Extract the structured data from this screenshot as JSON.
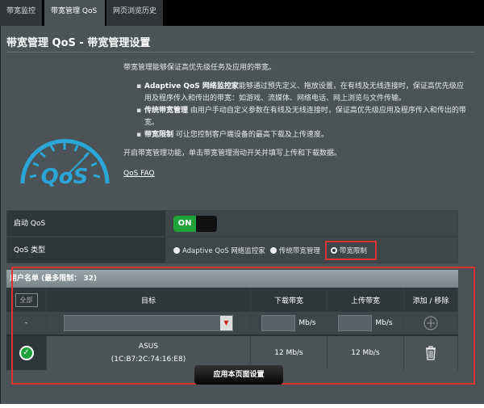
{
  "tabs": [
    {
      "label": "带宽监控"
    },
    {
      "label": "带宽管理 QoS"
    },
    {
      "label": "网页浏览历史"
    }
  ],
  "page_title": "带宽管理 QoS - 带宽管理设置",
  "logo_text": "QoS",
  "intro": "带宽管理能够保证高优先级任务及应用的带宽。",
  "bullets": [
    {
      "bold": "Adaptive QoS 网络监控家",
      "text": "能够通过预先定义、拖放设置，在有线及无线连接时，保证高优先级应用及程序传入和传出的带宽：如游戏、流媒体、网络电话、网上浏览与文件传输。"
    },
    {
      "bold": "传统带宽管理",
      "text": " 由用户手动自定义参数在有线及无线连接时，保证高优先级应用及程序传入和传出的带宽。"
    },
    {
      "bold": "带宽限制",
      "text": " 可让您控制客户端设备的最高下载及上传速度。"
    }
  ],
  "instruction": "开启带宽管理功能，单击带宽管理滑动开关并填写上传和下载数据。",
  "faq_link": "QoS FAQ",
  "settings": {
    "enable_label": "启动 QoS",
    "toggle_on": "ON",
    "type_label": "QoS 类型",
    "types": [
      {
        "label": "Adaptive QoS 网络监控家",
        "selected": false
      },
      {
        "label": "传统带宽管理",
        "selected": false
      },
      {
        "label": "带宽限制",
        "selected": true
      }
    ]
  },
  "user_list": {
    "title": "用户名单 (最多限制： 32)",
    "headers": {
      "all": "全部",
      "target": "目标",
      "download": "下载带宽",
      "upload": "上传带宽",
      "add_remove": "添加 / 移除"
    },
    "input_row": {
      "dash": "-",
      "unit": "Mb/s"
    },
    "rows": [
      {
        "name": "ASUS",
        "mac": "(1C:B7:2C:74:16:E8)",
        "download": "12 Mb/s",
        "upload": "12 Mb/s"
      }
    ]
  },
  "apply_button": "应用本页面设置"
}
